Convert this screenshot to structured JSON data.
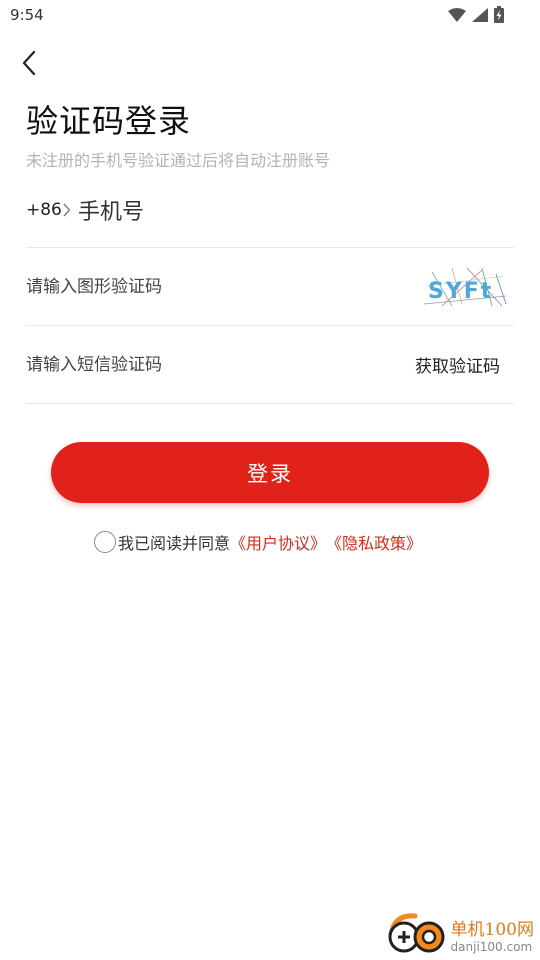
{
  "status_bar": {
    "time": "9:54",
    "icons": [
      "wifi-icon",
      "signal-icon",
      "battery-icon"
    ]
  },
  "nav": {
    "back_icon": "chevron-left-icon"
  },
  "header": {
    "title": "验证码登录",
    "subtitle": "未注册的手机号验证通过后将自动注册账号"
  },
  "form": {
    "country_code": "+86",
    "phone_placeholder": "手机号",
    "captcha_placeholder": "请输入图形验证码",
    "captcha_text": "SYFt",
    "sms_placeholder": "请输入短信验证码",
    "sms_button": "获取验证码"
  },
  "login_button": "登录",
  "agreement": {
    "prefix": "我已阅读并同意",
    "user_agreement": "《用户协议》",
    "privacy_policy": "《隐私政策》",
    "checked": false
  },
  "watermark": {
    "name": "单机100网",
    "url": "danji100.com"
  },
  "colors": {
    "accent": "#e0221b",
    "link": "#d42b1e",
    "subtitle": "#b3b3b3",
    "divider": "#e8e8e8"
  }
}
